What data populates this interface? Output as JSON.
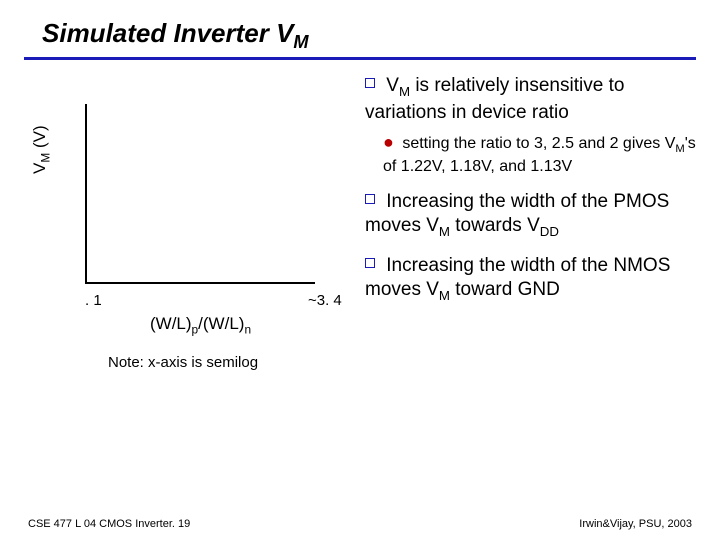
{
  "title_prefix": "Simulated Inverter V",
  "title_sub": "M",
  "chart_data": {
    "type": "line",
    "title": "",
    "xlabel_html": "(W/L)_p/(W/L)_n",
    "ylabel_html": "V_M (V)",
    "xscale": "log",
    "x_ticks": [
      ".1",
      "~3.4"
    ],
    "note": "Note: x-axis is semilog",
    "series": []
  },
  "axis": {
    "ylabel_pre": "V",
    "ylabel_sub": "M",
    "ylabel_post": " (V)",
    "xtick_left": ". 1",
    "xtick_right": "~3. 4",
    "xlabel_a": "(W/L)",
    "xlabel_a_sub": "p",
    "xlabel_mid": "/(W/L)",
    "xlabel_b_sub": "n",
    "note": "Note: x-axis is semilog"
  },
  "bullets": {
    "p1_a": "V",
    "p1_sub": "M",
    "p1_b": " is relatively insensitive to variations in device ratio",
    "p1s_a": "setting the ratio to 3, 2.5 and 2 gives V",
    "p1s_sub": "M",
    "p1s_b": "'s of 1.22V, 1.18V, and 1.13V",
    "p2_a": "Increasing the width of the PMOS moves V",
    "p2_sub": "M",
    "p2_b": " towards V",
    "p2_sub2": "DD",
    "p3_a": "Increasing the width of the NMOS moves V",
    "p3_sub": "M",
    "p3_b": " toward GND"
  },
  "footer": {
    "left": "CSE 477 L 04 CMOS Inverter. 19",
    "right": "Irwin&Vijay, PSU, 2003"
  }
}
